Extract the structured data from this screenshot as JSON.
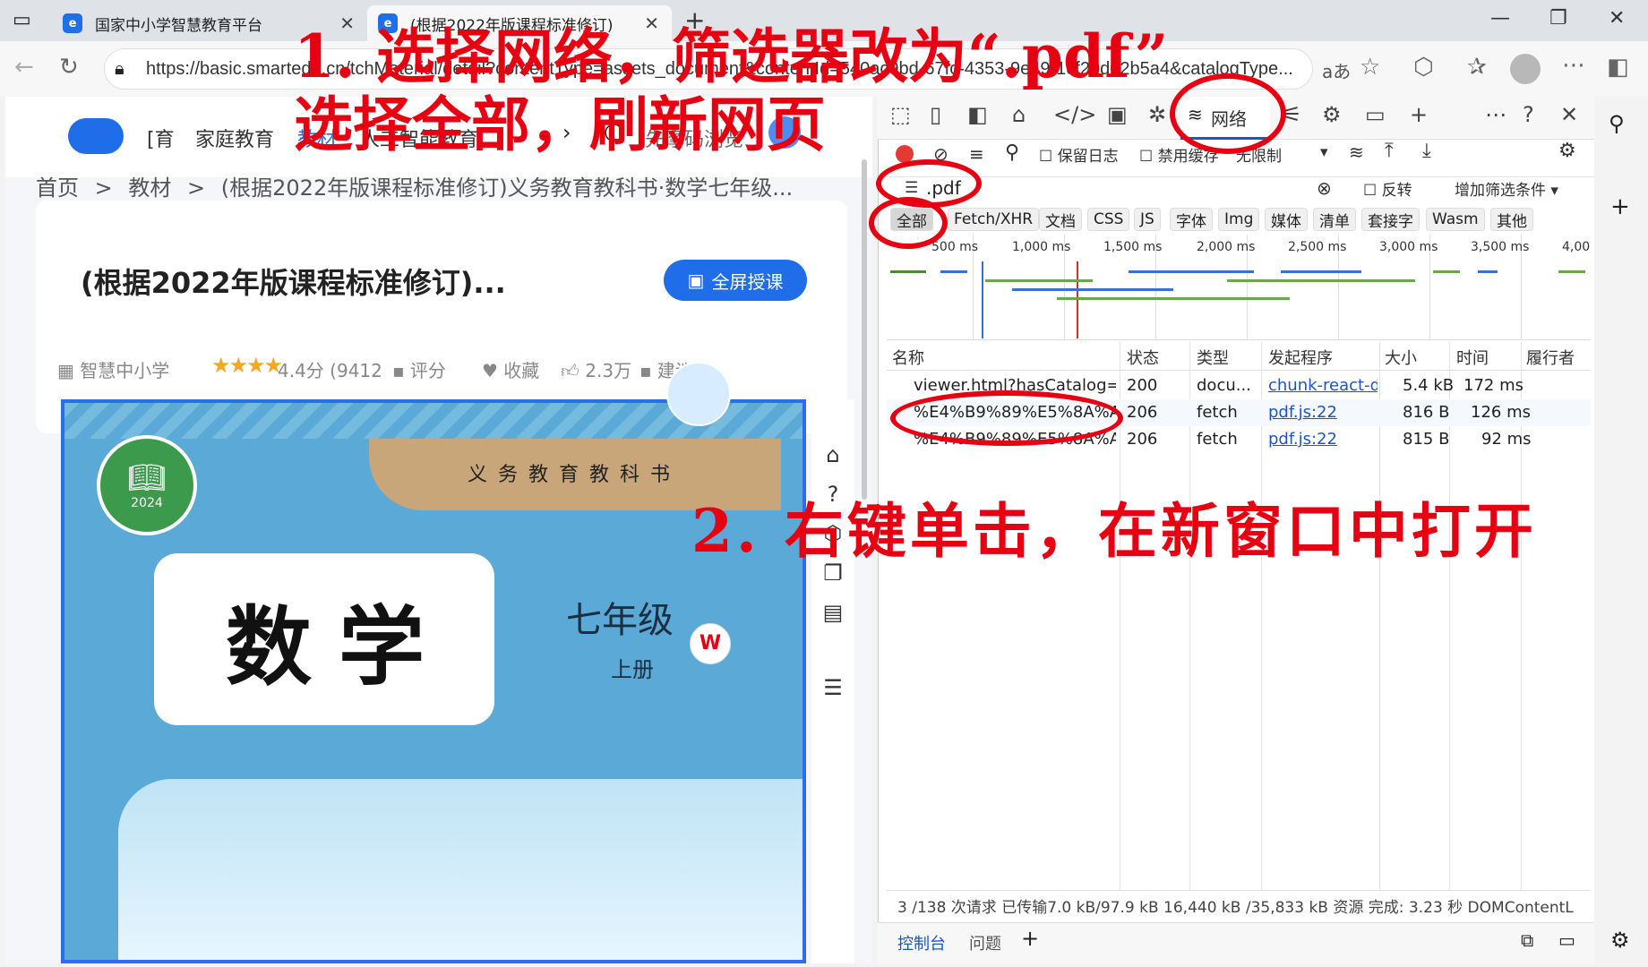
{
  "browser": {
    "tabs": [
      {
        "title": "国家中小学智慧教育平台"
      },
      {
        "title": "(根据2022年版课程标准修订)"
      }
    ],
    "url": "https://basic.smartedu.cn/tchMaterial/detail?contentType=assets_document&contentId=540ac9bd-67fc-4353-9e49-1cf20d02b5a4&catalogType...",
    "read_aloud": "aあ"
  },
  "site": {
    "nav": [
      "[育",
      "家庭教育",
      "教材",
      "人工智能教育"
    ],
    "browser_hint": "先摩码浏览",
    "breadcrumb": [
      "首页",
      ">",
      "教材",
      ">",
      "(根据2022年版课程标准修订)义务教育教科书·数学七年级..."
    ],
    "book_title": "(根据2022年版课程标准修订)...",
    "fullscreen_button": "全屏授课",
    "publisher": "智慧中小学",
    "rating": "4.4分 (9412",
    "rate_label": "评分",
    "favorite_label": "收藏",
    "likes": "2.3万",
    "suggest_label": "建议",
    "cover": {
      "series": "义务教育教科书",
      "subject": "数学",
      "grade": "七年级",
      "volume": "上册",
      "seal_year": "2024"
    }
  },
  "devtools": {
    "network_tab": "网络",
    "preserve_log": "保留日志",
    "disable_cache": "禁用缓存",
    "throttle": "无限制",
    "filter_value": ".pdf",
    "invert": "反转",
    "more_filters": "增加筛选条件",
    "type_chips": [
      "全部",
      "Fetch/XHR",
      "文档",
      "CSS",
      "JS",
      "字体",
      "Img",
      "媒体",
      "清单",
      "套接字",
      "Wasm",
      "其他"
    ],
    "timeline_ticks": [
      "500 ms",
      "1,000 ms",
      "1,500 ms",
      "2,000 ms",
      "2,500 ms",
      "3,000 ms",
      "3,500 ms",
      "4,00"
    ],
    "columns": [
      "名称",
      "状态",
      "类型",
      "发起程序",
      "大小",
      "时间",
      "履行者"
    ],
    "rows": [
      {
        "name": "viewer.html?hasCatalog=...",
        "status": "200",
        "type": "docu...",
        "initiator": "chunk-react-da",
        "size": "5.4 kB",
        "time": "172 ms"
      },
      {
        "name": "%E4%B9%89%E5%8A%A...",
        "status": "206",
        "type": "fetch",
        "initiator": "pdf.js:22",
        "size": "816 B",
        "time": "126 ms"
      },
      {
        "name": "%E4%B9%89%E5%8A%A...",
        "status": "206",
        "type": "fetch",
        "initiator": "pdf.js:22",
        "size": "815 B",
        "time": "92 ms"
      }
    ],
    "status_bar": "3 /138 次请求   已传输7.0 kB/97.9 kB   16,440 kB /35,833 kB 资源   完成: 3.23 秒   DOMContentL",
    "drawer_tabs": [
      "控制台",
      "问题"
    ]
  },
  "annotations": {
    "step1_line1": "1. 选择网络，筛选器改为“.pdf”",
    "step1_line2": "选择全部，刷新网页",
    "step2": "2. 右键单击，在新窗口中打开"
  }
}
